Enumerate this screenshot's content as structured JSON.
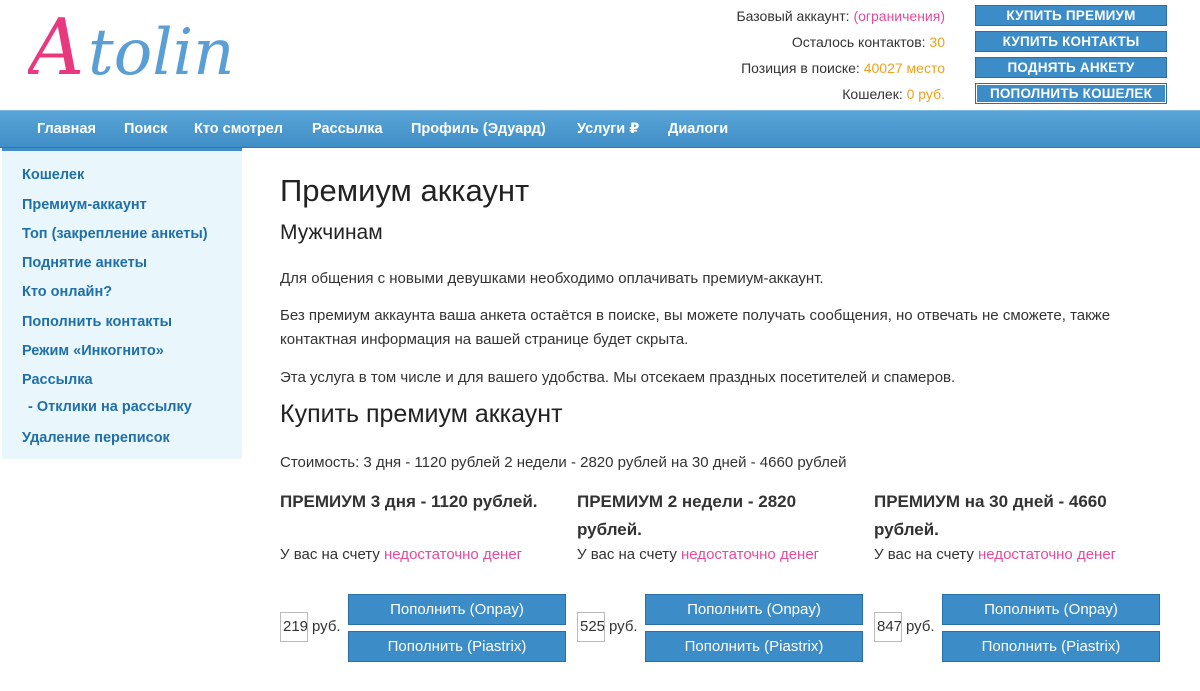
{
  "logo_text": "Atolin",
  "account": {
    "basic_label": "Базовый аккаунт:",
    "basic_value": "(ограничения)",
    "contacts_label": "Осталось контактов:",
    "contacts_value": "30",
    "position_label": "Позиция в поиске:",
    "position_value": "40027 место",
    "wallet_label": "Кошелек:",
    "wallet_value": "0 руб.",
    "buttons": [
      "КУПИТЬ ПРЕМИУМ",
      "КУПИТЬ КОНТАКТЫ",
      "ПОДНЯТЬ АНКЕТУ",
      "ПОПОЛНИТЬ КОШЕЛЕК"
    ]
  },
  "nav": [
    "Главная",
    "Поиск",
    "Кто смотрел",
    "Рассылка",
    "Профиль (Эдуард)",
    "Услуги ₽",
    "Диалоги"
  ],
  "sidebar": [
    "Кошелек",
    "Премиум-аккаунт",
    "Топ (закрепление анкеты)",
    "Поднятие анкеты",
    "Кто онлайн?",
    "Пополнить контакты",
    "Режим «Инкогнито»",
    "Рассылка",
    "- Отклики на рассылку",
    "Удаление переписок"
  ],
  "main": {
    "title": "Премиум аккаунт",
    "subtitle": "Мужчинам",
    "p1": "Для общения с новыми девушками необходимо оплачивать премиум-аккаунт.",
    "p2": "Без премиум аккаунта ваша анкета остаётся в поиске, вы можете получать сообщения, но отвечать не сможете, также контактная информация на вашей странице будет скрыта.",
    "p3": "Эта услуга в том числе и для вашего удобства. Мы отсекаем праздных посетителей и спамеров.",
    "buy_title": "Купить премиум аккаунт",
    "cost": "Стоимость: 3 дня - 1120 рублей 2 недели - 2820 рублей на 30 дней - 4660 рублей",
    "balance_prefix": "У вас на счету",
    "balance_warn": "недостаточно денег",
    "currency": "руб.",
    "offers": [
      {
        "title": "ПРЕМИУМ 3 дня - 1120 рублей.",
        "amount": "219"
      },
      {
        "title": "ПРЕМИУМ 2 недели - 2820 рублей.",
        "amount": "525"
      },
      {
        "title": "ПРЕМИУМ на 30 дней - 4660 рублей.",
        "amount": "847"
      }
    ],
    "pay_onpay": "Пополнить (Onpay)",
    "pay_piastrix": "Пополнить (Piastrix)"
  },
  "colors": {
    "accent_blue": "#3c8cc8",
    "pink": "#e54a9c",
    "orange": "#f0a020",
    "sidebar_bg": "#e9f6fb"
  }
}
